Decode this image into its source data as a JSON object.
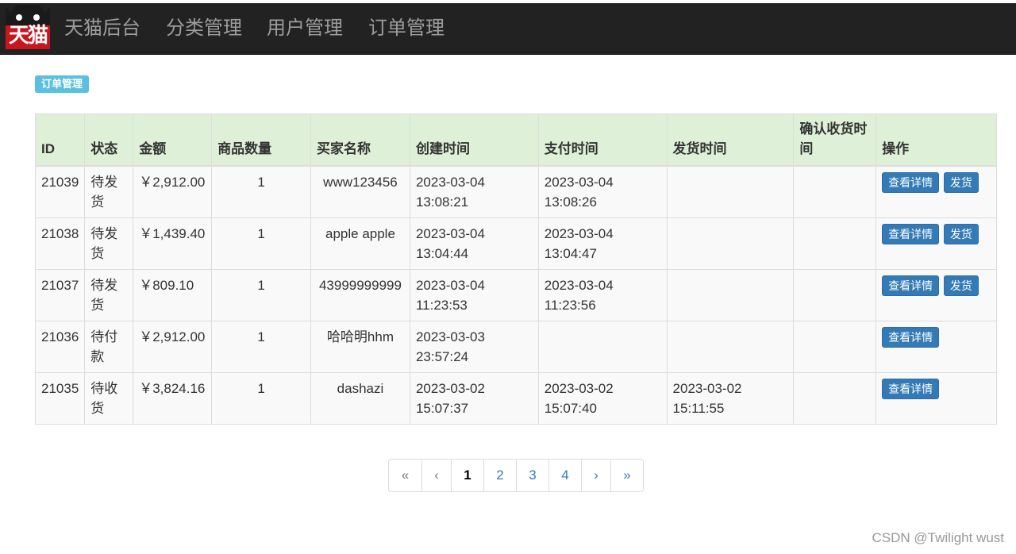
{
  "brand": {
    "logo_text": "天猫"
  },
  "nav": {
    "items": [
      "天猫后台",
      "分类管理",
      "用户管理",
      "订单管理"
    ]
  },
  "section": {
    "badge": "订单管理"
  },
  "table": {
    "headers": [
      "ID",
      "状态",
      "金额",
      "商品数量",
      "买家名称",
      "创建时间",
      "支付时间",
      "发货时间",
      "确认收货时间",
      "操作"
    ],
    "rows": [
      {
        "id": "21039",
        "status": "待发货",
        "amount": "￥2,912.00",
        "qty": "1",
        "buyer": "www123456",
        "created": "2023-03-04 13:08:21",
        "paid": "2023-03-04 13:08:26",
        "shipped": "",
        "confirmed": "",
        "actions": [
          "查看详情",
          "发货"
        ]
      },
      {
        "id": "21038",
        "status": "待发货",
        "amount": "￥1,439.40",
        "qty": "1",
        "buyer": "apple apple",
        "created": "2023-03-04 13:04:44",
        "paid": "2023-03-04 13:04:47",
        "shipped": "",
        "confirmed": "",
        "actions": [
          "查看详情",
          "发货"
        ]
      },
      {
        "id": "21037",
        "status": "待发货",
        "amount": "￥809.10",
        "qty": "1",
        "buyer": "43999999999",
        "created": "2023-03-04 11:23:53",
        "paid": "2023-03-04 11:23:56",
        "shipped": "",
        "confirmed": "",
        "actions": [
          "查看详情",
          "发货"
        ]
      },
      {
        "id": "21036",
        "status": "待付款",
        "amount": "￥2,912.00",
        "qty": "1",
        "buyer": "哈哈明hhm",
        "created": "2023-03-03 23:57:24",
        "paid": "",
        "shipped": "",
        "confirmed": "",
        "actions": [
          "查看详情"
        ]
      },
      {
        "id": "21035",
        "status": "待收货",
        "amount": "￥3,824.16",
        "qty": "1",
        "buyer": "dashazi",
        "created": "2023-03-02 15:07:37",
        "paid": "2023-03-02 15:07:40",
        "shipped": "2023-03-02 15:11:55",
        "confirmed": "",
        "actions": [
          "查看详情"
        ]
      }
    ]
  },
  "pagination": {
    "first": "«",
    "prev": "‹",
    "pages": [
      "1",
      "2",
      "3",
      "4"
    ],
    "current": "1",
    "next": "›",
    "last": "»"
  },
  "watermark": "CSDN @Twilight wust",
  "colors": {
    "navbar": "#222222",
    "header_row": "#dff0d8",
    "badge": "#5bc0de",
    "button": "#337ab7",
    "logo": "#c9151e"
  }
}
